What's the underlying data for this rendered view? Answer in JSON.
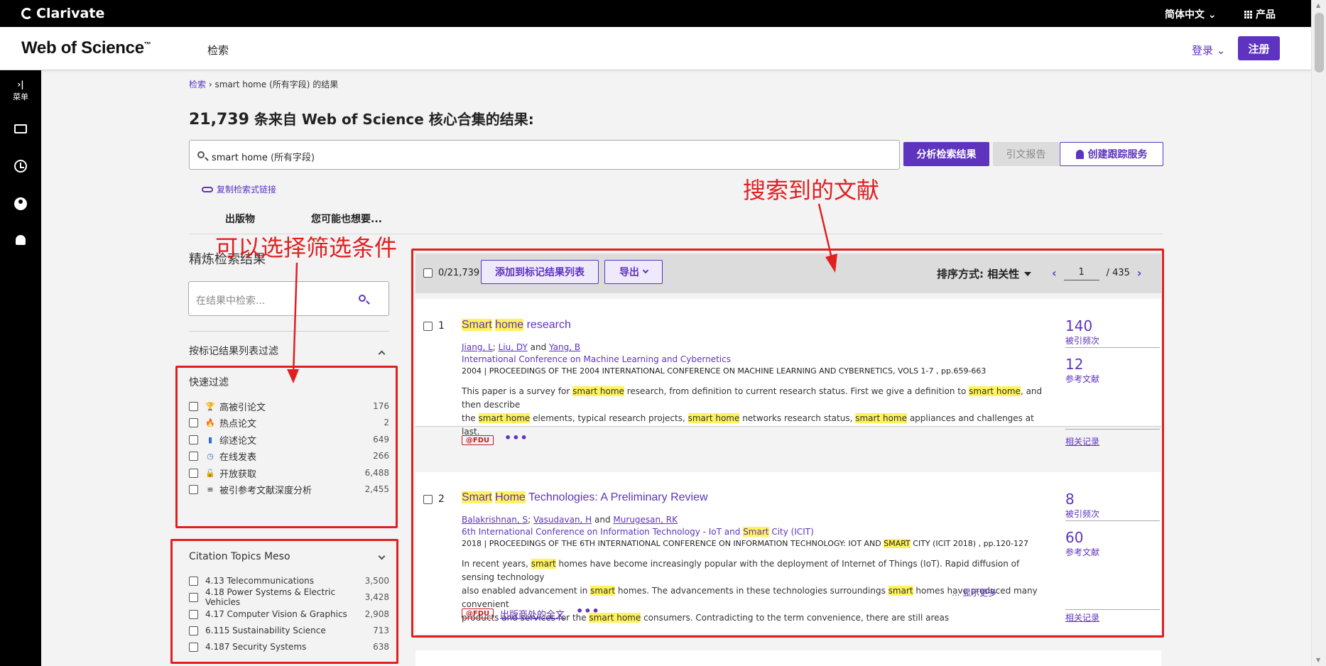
{
  "topbar": {
    "brand": "Clarivate",
    "language": "简体中文 ⌄",
    "products": "产品"
  },
  "header": {
    "logo": "Web of Science",
    "logo_tm": "™",
    "nav_search": "检索",
    "login": "登录 ⌄",
    "register": "注册"
  },
  "rail": {
    "menu_label": "菜单",
    "expand_glyph": "›|"
  },
  "breadcrumb": {
    "link": "检索",
    "separator": "›",
    "current": "smart home (所有字段) 的结果"
  },
  "result_heading": {
    "count": "21,739",
    "text": " 条来自 Web of Science 核心合集的结果:"
  },
  "search": {
    "query": "smart home",
    "field": " (所有字段)"
  },
  "actions": {
    "analyze": "分析检索结果",
    "citation_report": "引文报告",
    "create_alert": "创建跟踪服务",
    "copy_link": "复制检索式链接"
  },
  "tabs": [
    "出版物",
    "您可能也想要..."
  ],
  "refine": {
    "title": "精炼检索结果",
    "search_placeholder": "在结果中检索...",
    "marked_list_filter": "按标记结果列表过滤",
    "quick_filters_title": "快速过滤",
    "quick_filters": [
      {
        "label": "高被引论文",
        "count": "176",
        "icon": "trophy-icon",
        "glyph": "🏆",
        "color": "#c0392b"
      },
      {
        "label": "热点论文",
        "count": "2",
        "icon": "flame-icon",
        "glyph": "🔥",
        "color": "#e74c3c"
      },
      {
        "label": "综述论文",
        "count": "649",
        "icon": "document-icon",
        "glyph": "▮",
        "color": "#2f6fd0"
      },
      {
        "label": "在线发表",
        "count": "266",
        "icon": "clock-icon",
        "glyph": "◷",
        "color": "#2f6fd0"
      },
      {
        "label": "开放获取",
        "count": "6,488",
        "icon": "lock-open-icon",
        "glyph": "🔓",
        "color": "#222222"
      },
      {
        "label": "被引参考文献深度分析",
        "count": "2,455",
        "icon": "list-analysis-icon",
        "glyph": "≡",
        "color": "#222222"
      }
    ],
    "topics_title": "Citation Topics Meso",
    "topics": [
      {
        "label": "4.13 Telecommunications",
        "count": "3,500"
      },
      {
        "label": "4.18 Power Systems & Electric Vehicles",
        "count": "3,428"
      },
      {
        "label": "4.17 Computer Vision & Graphics",
        "count": "2,908"
      },
      {
        "label": "6.115 Sustainability Science",
        "count": "713"
      },
      {
        "label": "4.187 Security Systems",
        "count": "638"
      }
    ]
  },
  "toolbar": {
    "selected_count": "0/21,739",
    "add_to_marked": "添加到标记结果列表",
    "export": "导出",
    "sort_label": "排序方式: 相关性",
    "page": "1",
    "total_pages": "/ 435"
  },
  "results": [
    {
      "rank": "1",
      "title_parts": [
        "Smart",
        " ",
        "home",
        " research"
      ],
      "authors": [
        "Jiang, L",
        "Liu, DY",
        "Yang, B"
      ],
      "author_joiners": [
        "; ",
        " and "
      ],
      "conference": "International Conference on Machine Learning and Cybernetics",
      "source": "2004 | PROCEEDINGS OF THE 2004 INTERNATIONAL CONFERENCE ON MACHINE LEARNING AND CYBERNETICS, VOLS 1-7 , pp.659-663",
      "abstract_line1": [
        "This paper is a survey for ",
        "smart home",
        " research, from definition to current research status. First we give a definition to ",
        "smart home",
        ", and then describe"
      ],
      "abstract_line2": [
        "the ",
        "smart home",
        " elements, typical research projects, ",
        "smart home",
        " networks research status, ",
        "smart home",
        " appliances and challenges at last."
      ],
      "times_cited": "140",
      "times_cited_label": "被引频次",
      "references": "12",
      "references_label": "参考文献",
      "related": "相关记录",
      "library_badge": "@FDU"
    },
    {
      "rank": "2",
      "title_parts": [
        "Smart",
        " ",
        "Home",
        " Technologies: A Preliminary Review"
      ],
      "authors": [
        "Balakrishnan, S",
        "Vasudavan, H",
        "Murugesan, RK"
      ],
      "author_joiners": [
        "; ",
        " and "
      ],
      "conference_parts": [
        "6th International Conference on Information Technology - IoT and ",
        "Smart",
        " City (ICIT)"
      ],
      "source_parts": [
        "2018 | PROCEEDINGS OF THE 6TH INTERNATIONAL CONFERENCE ON INFORMATION TECHNOLOGY: IOT AND ",
        "SMART",
        " CITY (ICIT 2018) , pp.120-127"
      ],
      "abstract_line1": [
        "In recent years, ",
        "smart",
        " homes have become increasingly popular with the deployment of Internet of Things (IoT). Rapid diffusion of sensing technology"
      ],
      "abstract_line2": [
        "also enabled advancement in ",
        "smart",
        " homes. The advancements in these technologies surroundings ",
        "smart",
        " homes have produced many convenient"
      ],
      "abstract_line3": [
        "products and services for the ",
        "smart home",
        " consumers. Contradicting to the term convenience, there are still areas"
      ],
      "show_more": "...    显示更多",
      "times_cited": "8",
      "times_cited_label": "被引频次",
      "references": "60",
      "references_label": "参考文献",
      "related": "相关记录",
      "library_badge": "@FDU",
      "full_text": "出版商处的全文"
    }
  ],
  "annotations": {
    "filters": "可以选择筛选条件",
    "results": "搜索到的文献",
    "color": "#e02020"
  }
}
